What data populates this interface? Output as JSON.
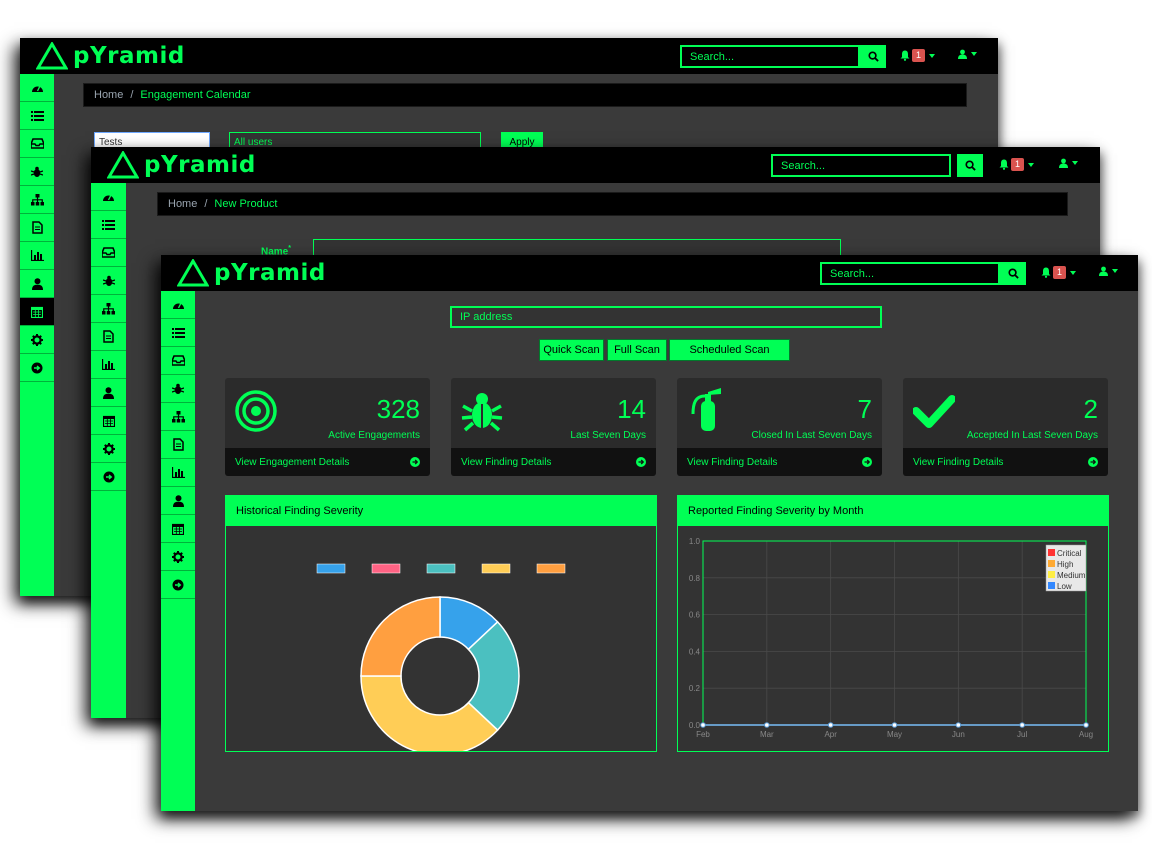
{
  "brand": "pYramid",
  "search_placeholder": "Search...",
  "notifications_count": "1",
  "back_window": {
    "breadcrumb": {
      "home": "Home",
      "current": "Engagement Calendar"
    },
    "filters": {
      "tests_select": "Tests",
      "users_select": "All users",
      "apply_label": "Apply"
    }
  },
  "middle_window": {
    "breadcrumb": {
      "home": "Home",
      "current": "New Product"
    },
    "name_label": "Name",
    "required_mark": "*"
  },
  "front_window": {
    "ip_placeholder": "IP address",
    "scan_buttons": {
      "quick": "Quick Scan",
      "full": "Full Scan",
      "scheduled": "Scheduled Scan"
    },
    "cards": [
      {
        "value": "328",
        "label": "Active Engagements",
        "link": "View Engagement Details",
        "icon": "bullseye-icon"
      },
      {
        "value": "14",
        "label": "Last Seven Days",
        "link": "View Finding Details",
        "icon": "bug-icon"
      },
      {
        "value": "7",
        "label": "Closed In Last Seven Days",
        "link": "View Finding Details",
        "icon": "fire-extinguisher-icon"
      },
      {
        "value": "2",
        "label": "Accepted In Last Seven Days",
        "link": "View Finding Details",
        "icon": "check-icon"
      }
    ],
    "panels": {
      "historical": "Historical Finding Severity",
      "monthly": "Reported Finding Severity by Month"
    }
  },
  "sidebar_icons": [
    "dashboard-icon",
    "list-icon",
    "inbox-icon",
    "bug-icon",
    "sitemap-icon",
    "file-icon",
    "bar-chart-icon",
    "user-icon",
    "calendar-icon",
    "gear-icon",
    "sign-in-icon"
  ],
  "colors": {
    "accent": "#00ff55",
    "background": "#3a3a3a",
    "bar": "#000000",
    "badge": "#d9534f"
  },
  "chart_data": [
    {
      "type": "pie",
      "variant": "doughnut",
      "slices": [
        {
          "value": 13,
          "color": "#36a2eb"
        },
        {
          "value": 24,
          "color": "#4bc0c0"
        },
        {
          "value": 38,
          "color": "#ffcd56"
        },
        {
          "value": 25,
          "color": "#ff9f40"
        }
      ],
      "legend_swatches": [
        "#36a2eb",
        "#ff6384",
        "#4bc0c0",
        "#ffcd56",
        "#ff9f40"
      ],
      "legend_position": "top"
    },
    {
      "type": "line",
      "categories": [
        "Feb",
        "Mar",
        "Apr",
        "May",
        "Jun",
        "Jul",
        "Aug"
      ],
      "series": [
        {
          "name": "Critical",
          "color": "#ff3333",
          "values": [
            0,
            0,
            0,
            0,
            0,
            0,
            0
          ]
        },
        {
          "name": "High",
          "color": "#ffaa33",
          "values": [
            0,
            0,
            0,
            0,
            0,
            0,
            0
          ]
        },
        {
          "name": "Medium",
          "color": "#ffee44",
          "values": [
            0,
            0,
            0,
            0,
            0,
            0,
            0
          ]
        },
        {
          "name": "Low",
          "color": "#3388ff",
          "values": [
            0,
            0,
            0,
            0,
            0,
            0,
            0
          ]
        }
      ],
      "yticks": [
        "0.0",
        "0.2",
        "0.4",
        "0.6",
        "0.8",
        "1.0"
      ],
      "ylim": [
        0,
        1
      ],
      "grid": true,
      "legend_position": "top-right"
    }
  ]
}
